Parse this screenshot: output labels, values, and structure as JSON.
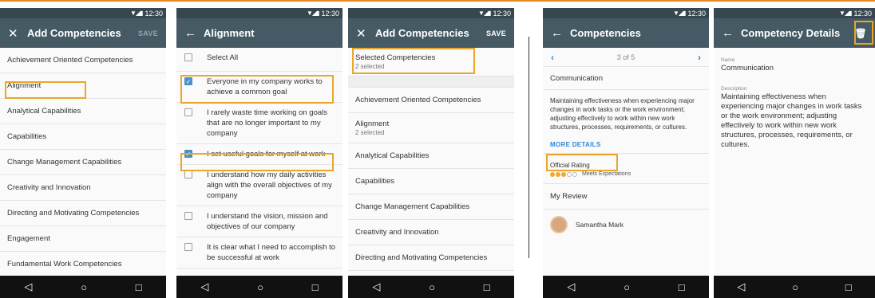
{
  "status_time": "12:30",
  "status_signal": "▼◢▮",
  "nav": {
    "back": "◁",
    "home": "○",
    "recent": "□"
  },
  "screen1": {
    "title": "Add Competencies",
    "close_icon": "✕",
    "action": "SAVE",
    "items": [
      "Achievement Oriented Competencies",
      "Alignment",
      "Analytical Capabilities",
      "Capabilities",
      "Change Management Capabilities",
      "Creativity and Innovation",
      "Directing and Motivating Competencies",
      "Engagement",
      "Fundamental Work Competencies"
    ]
  },
  "screen2": {
    "title": "Alignment",
    "back_icon": "←",
    "items": [
      {
        "label": "Select All",
        "checked": false
      },
      {
        "label": "Everyone in my company works to achieve a common goal",
        "checked": true
      },
      {
        "label": "I rarely waste time working on goals that are no longer important to my company",
        "checked": false
      },
      {
        "label": "I set useful goals for myself at work",
        "checked": true
      },
      {
        "label": "I understand how my daily activities align with the overall objectives of my company",
        "checked": false
      },
      {
        "label": "I understand the vision, mission and objectives of our company",
        "checked": false
      },
      {
        "label": "It is clear what I need to accomplish to be successful at work",
        "checked": false
      }
    ]
  },
  "screen3": {
    "title": "Add Competencies",
    "close_icon": "✕",
    "action": "SAVE",
    "selected_title": "Selected Competencies",
    "selected_sub": "2 selected",
    "items": [
      {
        "label": "Achievement Oriented Competencies",
        "sub": ""
      },
      {
        "label": "Alignment",
        "sub": "2 selected"
      },
      {
        "label": "Analytical Capabilities",
        "sub": ""
      },
      {
        "label": "Capabilities",
        "sub": ""
      },
      {
        "label": "Change Management Capabilities",
        "sub": ""
      },
      {
        "label": "Creativity and Innovation",
        "sub": ""
      },
      {
        "label": "Directing and Motivating Competencies",
        "sub": ""
      }
    ]
  },
  "screen4": {
    "title": "Competencies",
    "back_icon": "←",
    "pager": {
      "prev": "‹",
      "label": "3 of 5",
      "next": "›"
    },
    "competency": "Communication",
    "description": "Maintaining effectiveness when experiencing major changes in work tasks or the work environment; adjusting effectively to work within new work structures, processes, requirements, or cultures.",
    "more_details": "MORE DETAILS",
    "official_rating_label": "Official Rating",
    "rating": {
      "filled": 3,
      "total": 5,
      "text": "Meets Expectations"
    },
    "my_review": "My Review",
    "reviewer": "Samantha Mark"
  },
  "screen5": {
    "title": "Competency Details",
    "back_icon": "←",
    "delete_icon": "🗑",
    "name_label": "Name",
    "name_value": "Communication",
    "description_label": "Description",
    "description_value": "Maintaining effectiveness when experiencing major changes in work tasks or the work environment; adjusting effectively to work within new work structures, processes, requirements, or cultures."
  },
  "colors": {
    "appbar": "#455a64",
    "statusbar": "#37474f",
    "highlight": "#e9a62b",
    "checkbox": "#4a90c8",
    "link": "#2e86de"
  }
}
